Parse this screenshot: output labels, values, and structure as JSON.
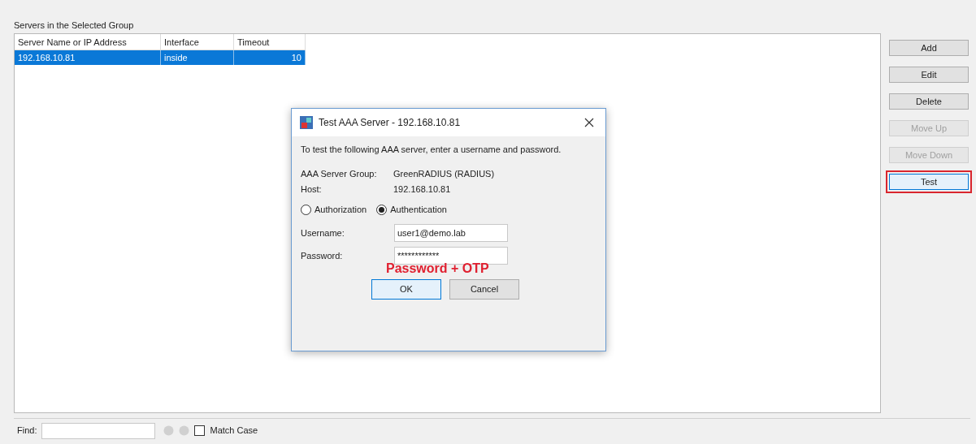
{
  "panel_title": "Servers in the Selected Group",
  "table": {
    "columns": [
      "Server Name or IP Address",
      "Interface",
      "Timeout"
    ],
    "rows": [
      {
        "cells": [
          "192.168.10.81",
          "inside",
          "10"
        ],
        "selected": true
      }
    ]
  },
  "buttons": [
    {
      "label": "Add",
      "disabled": false,
      "highlighted": false
    },
    {
      "label": "Edit",
      "disabled": false,
      "highlighted": false
    },
    {
      "label": "Delete",
      "disabled": false,
      "highlighted": false
    },
    {
      "label": "Move Up",
      "disabled": true,
      "highlighted": false
    },
    {
      "label": "Move Down",
      "disabled": true,
      "highlighted": false
    },
    {
      "label": "Test",
      "disabled": false,
      "highlighted": true
    }
  ],
  "find_bar": {
    "label": "Find:",
    "match_case": {
      "label": "Match Case",
      "checked": false
    }
  },
  "dialog": {
    "title": "Test AAA Server - 192.168.10.81",
    "intro": "To test the following AAA server, enter a username and password.",
    "info": [
      {
        "label": "AAA Server Group:",
        "value": "GreenRADIUS (RADIUS)"
      },
      {
        "label": "Host:",
        "value": "192.168.10.81"
      }
    ],
    "modes": [
      {
        "label": "Authorization",
        "selected": false
      },
      {
        "label": "Authentication",
        "selected": true
      }
    ],
    "fields": [
      {
        "label": "Username:",
        "value": "user1@demo.lab"
      },
      {
        "label": "Password:",
        "value": "************"
      }
    ],
    "annotation": "Password + OTP",
    "buttons": [
      {
        "label": "OK",
        "default": true
      },
      {
        "label": "Cancel",
        "default": false
      }
    ]
  }
}
